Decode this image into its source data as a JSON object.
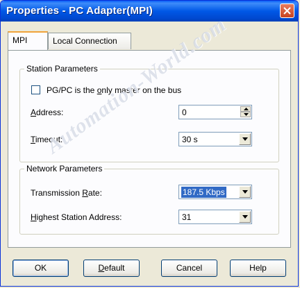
{
  "window": {
    "title": "Properties - PC Adapter(MPI)"
  },
  "tabs": [
    {
      "label": "MPI"
    },
    {
      "label": "Local Connection"
    }
  ],
  "station": {
    "group_title": "Station Parameters",
    "only_master": {
      "label_pre": "PG/PC is the ",
      "label_u": "o",
      "label_post": "nly master on the bus",
      "checked": false
    },
    "address": {
      "label_u": "A",
      "label_rest": "ddress:",
      "value": "0"
    },
    "timeout": {
      "label_u": "T",
      "label_rest": "imeout:",
      "value": "30 s"
    }
  },
  "network": {
    "group_title": "Network Parameters",
    "rate": {
      "label_pre": "Transmission ",
      "label_u": "R",
      "label_post": "ate:",
      "value": "187.5 Kbps"
    },
    "highest": {
      "label_u": "H",
      "label_rest": "ighest Station Address:",
      "value": "31"
    }
  },
  "buttons": {
    "ok": "OK",
    "default_u": "D",
    "default_rest": "efault",
    "cancel": "Cancel",
    "help": "Help"
  },
  "watermark": "Automation-World.com",
  "icons": {
    "close": "close-icon",
    "arrow": "chevron-down-icon"
  }
}
